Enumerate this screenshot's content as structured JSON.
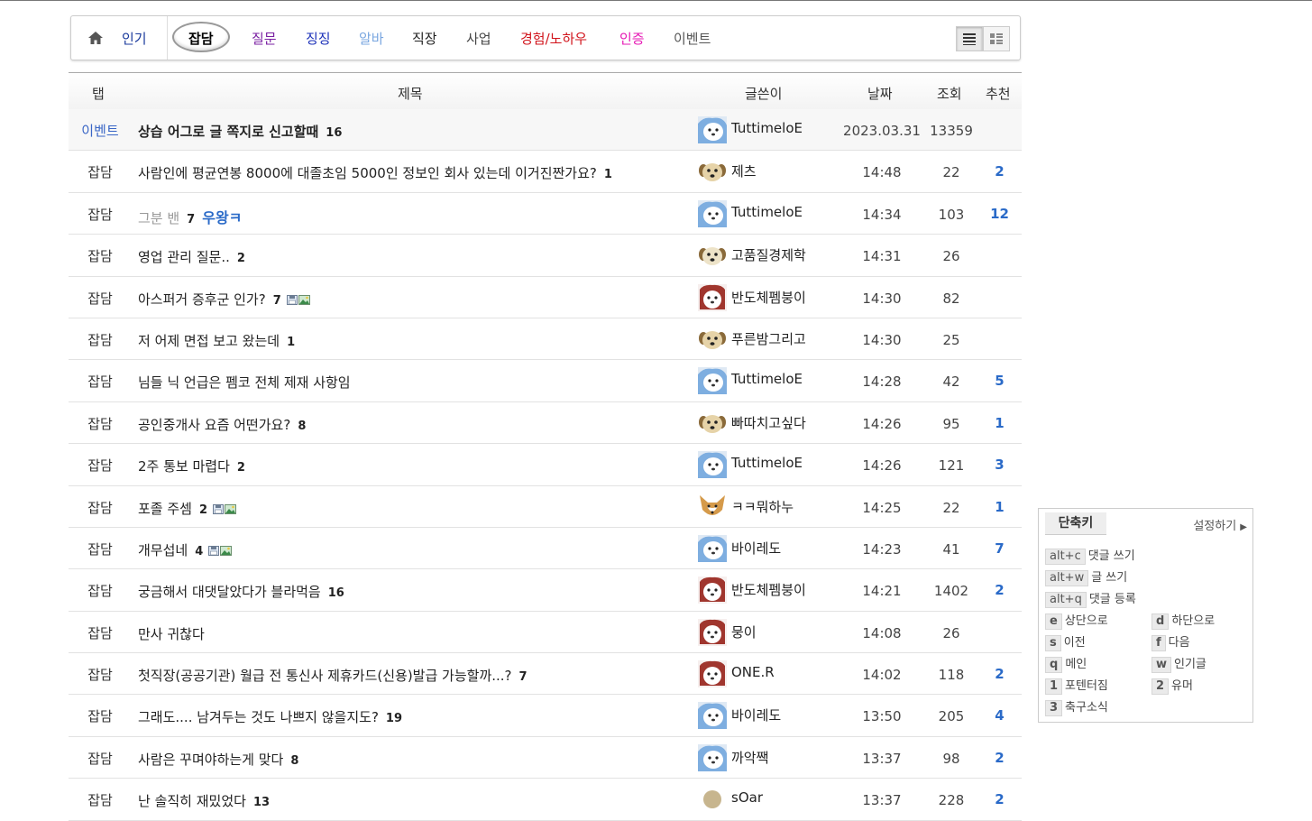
{
  "nav": {
    "home_label": "인기",
    "tabs": [
      {
        "label": "잡담",
        "color": "#000000"
      },
      {
        "label": "질문",
        "color": "#7a1fa2"
      },
      {
        "label": "징징",
        "color": "#1a2fb8"
      },
      {
        "label": "알바",
        "color": "#7aa7e0"
      },
      {
        "label": "직장",
        "color": "#222222"
      },
      {
        "label": "사업",
        "color": "#444444"
      },
      {
        "label": "경험/노하우",
        "color": "#d1131b"
      },
      {
        "label": "인증",
        "color": "#e61ab5"
      },
      {
        "label": "이벤트",
        "color": "#555555"
      }
    ],
    "active_tab": "잡담"
  },
  "table": {
    "headers": {
      "tab": "탭",
      "title": "제목",
      "author": "글쓴이",
      "date": "날짜",
      "views": "조회",
      "recommend": "추천"
    },
    "rows": [
      {
        "tab": "이벤트",
        "title": "상습 어그로 글 쪽지로 신고할때",
        "comments": "16",
        "author": "TuttimeloE",
        "avatar": "white-puppy",
        "date": "2023.03.31",
        "views": "13359",
        "recommend": "",
        "notice": true
      },
      {
        "tab": "잡담",
        "title": "사람인에 평균연봉 8000에 대졸초임 5000인 정보인 회사 있는데 이거진짠가요?",
        "comments": "1",
        "author": "제츠",
        "avatar": "dog-face",
        "date": "14:48",
        "views": "22",
        "recommend": "2"
      },
      {
        "tab": "잡담",
        "title": "그분 밴",
        "comments": "7",
        "deco": "우왕ㅋ",
        "author": "TuttimeloE",
        "avatar": "white-puppy",
        "date": "14:34",
        "views": "103",
        "recommend": "12",
        "gray": true
      },
      {
        "tab": "잡담",
        "title": "영업 관리 질문..",
        "comments": "2",
        "author": "고품질경제학",
        "avatar": "dog-face-light",
        "date": "14:31",
        "views": "26",
        "recommend": ""
      },
      {
        "tab": "잡담",
        "title": "아스퍼거 증후군 인가?",
        "comments": "7",
        "files": true,
        "author": "반도체펨붕이",
        "avatar": "red-dog",
        "date": "14:30",
        "views": "82",
        "recommend": ""
      },
      {
        "tab": "잡담",
        "title": "저 어제 면접 보고 왔는데",
        "comments": "1",
        "author": "푸른밤그리고",
        "avatar": "dog-face",
        "date": "14:30",
        "views": "25",
        "recommend": ""
      },
      {
        "tab": "잡담",
        "title": "님들 닉 언급은 펨코 전체 제재 사항임",
        "comments": "",
        "author": "TuttimeloE",
        "avatar": "white-puppy",
        "date": "14:28",
        "views": "42",
        "recommend": "5"
      },
      {
        "tab": "잡담",
        "title": "공인중개사 요즘 어떤가요?",
        "comments": "8",
        "author": "빠따치고싶다",
        "avatar": "dog-face",
        "date": "14:26",
        "views": "95",
        "recommend": "1"
      },
      {
        "tab": "잡담",
        "title": "2주 통보 마렵다",
        "comments": "2",
        "author": "TuttimeloE",
        "avatar": "white-puppy",
        "date": "14:26",
        "views": "121",
        "recommend": "3"
      },
      {
        "tab": "잡담",
        "title": "포졸 주셈",
        "comments": "2",
        "files": true,
        "author": "ㅋㅋ뭐하누",
        "avatar": "fox",
        "date": "14:25",
        "views": "22",
        "recommend": "1"
      },
      {
        "tab": "잡담",
        "title": "개무섭네",
        "comments": "4",
        "files": true,
        "author": "바이레도",
        "avatar": "white-puppy",
        "date": "14:23",
        "views": "41",
        "recommend": "7"
      },
      {
        "tab": "잡담",
        "title": "궁금해서 대댓달았다가 블라먹음",
        "comments": "16",
        "author": "반도체펨붕이",
        "avatar": "red-dog",
        "date": "14:21",
        "views": "1402",
        "recommend": "2"
      },
      {
        "tab": "잡담",
        "title": "만사 귀찮다",
        "comments": "",
        "author": "뭉이",
        "avatar": "red-dog",
        "date": "14:08",
        "views": "26",
        "recommend": ""
      },
      {
        "tab": "잡담",
        "title": "첫직장(공공기관) 월급 전 통신사 제휴카드(신용)발급 가능할까...?",
        "comments": "7",
        "author": "ONE.R",
        "avatar": "red-dog",
        "date": "14:02",
        "views": "118",
        "recommend": "2"
      },
      {
        "tab": "잡담",
        "title": "그래도.... 남겨두는 것도 나쁘지 않을지도?",
        "comments": "19",
        "author": "바이레도",
        "avatar": "white-puppy",
        "date": "13:50",
        "views": "205",
        "recommend": "4"
      },
      {
        "tab": "잡담",
        "title": "사람은 꾸며야하는게 맞다",
        "comments": "8",
        "author": "까악짹",
        "avatar": "white-puppy",
        "date": "13:37",
        "views": "98",
        "recommend": "2"
      },
      {
        "tab": "잡담",
        "title": "난 솔직히 재밌었다",
        "comments": "13",
        "author": "sOar",
        "avatar": "dot",
        "date": "13:37",
        "views": "228",
        "recommend": "2"
      }
    ]
  },
  "shortcuts": {
    "title": "단축키",
    "settings": "설정하기",
    "wide": [
      {
        "key": "alt+c",
        "desc": "댓글 쓰기"
      },
      {
        "key": "alt+w",
        "desc": "글 쓰기"
      },
      {
        "key": "alt+q",
        "desc": "댓글 등록"
      }
    ],
    "left": [
      {
        "key": "e",
        "desc": "상단으로"
      },
      {
        "key": "s",
        "desc": "이전"
      },
      {
        "key": "q",
        "desc": "메인"
      },
      {
        "key": "1",
        "desc": "포텐터짐"
      },
      {
        "key": "3",
        "desc": "축구소식"
      }
    ],
    "right": [
      {
        "key": "d",
        "desc": "하단으로"
      },
      {
        "key": "f",
        "desc": "다음"
      },
      {
        "key": "w",
        "desc": "인기글"
      },
      {
        "key": "2",
        "desc": "유머"
      }
    ]
  }
}
